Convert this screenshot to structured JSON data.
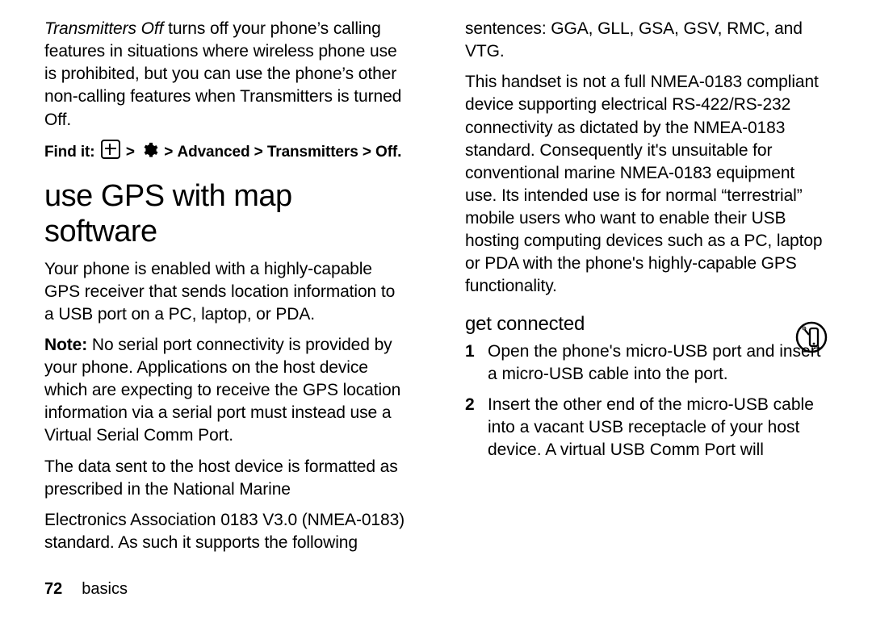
{
  "col1": {
    "transmitters_lead": "Transmitters Off",
    "transmitters_rest": " turns off your phone’s calling features in situations where wireless phone use is prohibited, but you can use the phone’s other non-calling features when Transmitters is turned Off.",
    "findit_label": "Find it:",
    "findit_path_tail": "Advanced > Transmitters > Off",
    "h1": "use GPS with map software",
    "p1": "Your phone is enabled with a highly-capable GPS receiver that sends location information to a USB port on a PC, laptop, or PDA.",
    "note_label": "Note:",
    "note_rest": " No serial port connectivity is provided by your phone. Applications on the host device which are expecting to receive the GPS location information via a serial port must instead use a Virtual Serial Comm Port.",
    "p3": "The data sent to the host device is formatted as prescribed in the National Marine"
  },
  "col2": {
    "p1": "Electronics Association 0183 V3.0 (NMEA-0183) standard. As such it supports the following sentences: GGA, GLL, GSA, GSV, RMC, and VTG.",
    "p2": "This handset is not a full NMEA-0183 compliant device supporting electrical RS-422/RS-232 connectivity as dictated by the NMEA-0183 standard. Consequently it's unsuitable for conventional marine NMEA-0183 equipment use. Its intended use is for normal “terrestrial” mobile users who want to enable their USB hosting computing devices such as a PC, laptop or PDA with the phone's highly-capable GPS functionality.",
    "sub": "get connected",
    "steps": [
      {
        "num": "1",
        "text": "Open the phone's micro-USB port and insert a micro-USB cable into the port."
      },
      {
        "num": "2",
        "text": "Insert the other end of the micro-USB cable into a vacant USB receptacle of your host device. A virtual USB Comm Port will"
      }
    ]
  },
  "footer": {
    "pageno": "72",
    "section": "basics"
  }
}
